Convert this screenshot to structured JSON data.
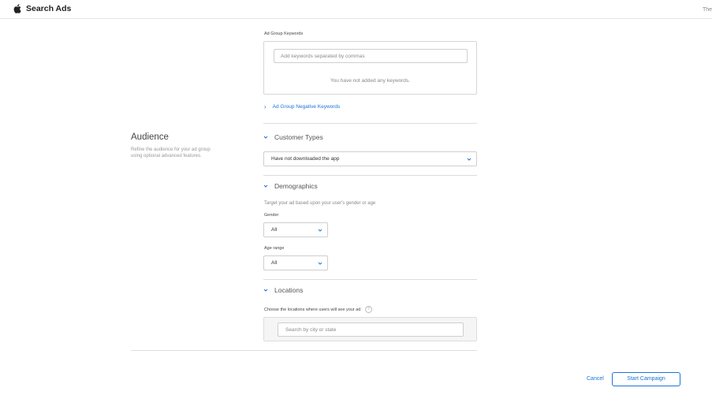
{
  "header": {
    "brand": "Search Ads",
    "right_text": "The"
  },
  "keywords": {
    "label": "Ad Group Keywords",
    "placeholder": "Add keywords separated by commas",
    "empty_message": "You have not added any keywords.",
    "negative_link": "Ad Group Negative Keywords"
  },
  "audience": {
    "title": "Audience",
    "description": "Refine the audience for your ad group using optional advanced features."
  },
  "customer_types": {
    "title": "Customer Types",
    "selected": "Have not downloaded the app"
  },
  "demographics": {
    "title": "Demographics",
    "description": "Target your ad based upon your user's gender or age",
    "gender_label": "Gender",
    "gender_value": "All",
    "age_label": "Age range",
    "age_value": "All"
  },
  "locations": {
    "title": "Locations",
    "description": "Choose the locations where users will see your ad",
    "help_glyph": "?",
    "placeholder": "Search by city or state"
  },
  "footer": {
    "cancel_label": "Cancel",
    "start_label": "Start Campaign"
  },
  "colors": {
    "accent": "#1a73d8",
    "border": "#cfcfcf"
  }
}
